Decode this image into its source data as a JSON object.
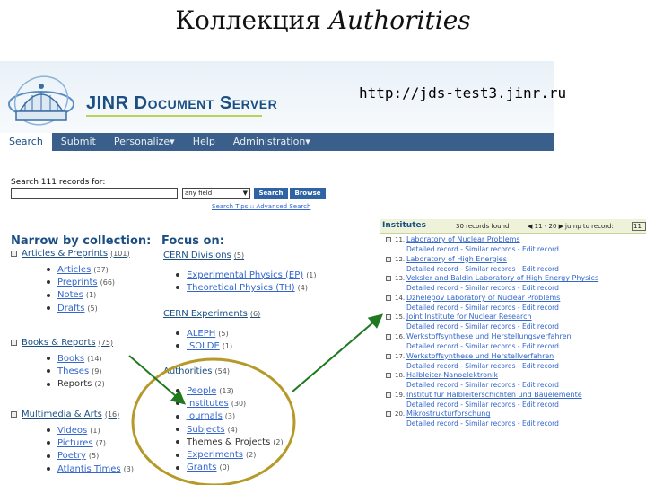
{
  "slide": {
    "title_plain": "Коллекция ",
    "title_italic": "Authorities"
  },
  "header": {
    "logo_text": "JINR Document Server",
    "url": "http://jds-test3.jinr.ru"
  },
  "nav": {
    "tabs": [
      "Search",
      "Submit",
      "Personalize▾",
      "Help",
      "Administration▾"
    ]
  },
  "search": {
    "label": "Search 111 records for:",
    "field_value": "any field",
    "search_button": "Search",
    "browse_button": "Browse",
    "links": "Search Tips :: Advanced Search"
  },
  "narrow": {
    "heading": "Narrow by collection:",
    "groups": [
      {
        "label": "Articles & Preprints",
        "count": "(101)",
        "items": [
          {
            "label": "Articles",
            "count": "(37)",
            "link": true
          },
          {
            "label": "Preprints",
            "count": "(66)",
            "link": true
          },
          {
            "label": "Notes",
            "count": "(1)",
            "link": true
          },
          {
            "label": "Drafts",
            "count": "(5)",
            "link": true
          }
        ]
      },
      {
        "label": "Books & Reports",
        "count": "(75)",
        "items": [
          {
            "label": "Books",
            "count": "(14)",
            "link": true
          },
          {
            "label": "Theses",
            "count": "(9)",
            "link": true
          },
          {
            "label": "Reports",
            "count": "(2)",
            "link": false
          }
        ]
      },
      {
        "label": "Multimedia & Arts",
        "count": "(16)",
        "items": [
          {
            "label": "Videos",
            "count": "(1)",
            "link": true
          },
          {
            "label": "Pictures",
            "count": "(7)",
            "link": true
          },
          {
            "label": "Poetry",
            "count": "(5)",
            "link": true
          },
          {
            "label": "Atlantis Times",
            "count": "(3)",
            "link": true
          }
        ]
      }
    ]
  },
  "focus": {
    "heading": "Focus on:",
    "groups": [
      {
        "label": "CERN Divisions",
        "count": "(5)",
        "items": [
          {
            "label": "Experimental Physics (EP)",
            "count": "(1)",
            "link": true
          },
          {
            "label": "Theoretical Physics (TH)",
            "count": "(4)",
            "link": true
          }
        ]
      },
      {
        "label": "CERN Experiments",
        "count": "(6)",
        "items": [
          {
            "label": "ALEPH",
            "count": "(5)",
            "link": true
          },
          {
            "label": "ISOLDE",
            "count": "(1)",
            "link": true
          }
        ]
      },
      {
        "label": "Authorities",
        "count": "(54)",
        "items": [
          {
            "label": "People",
            "count": "(13)",
            "link": true
          },
          {
            "label": "Institutes",
            "count": "(30)",
            "link": true
          },
          {
            "label": "Journals",
            "count": "(3)",
            "link": true
          },
          {
            "label": "Subjects",
            "count": "(4)",
            "link": true
          },
          {
            "label": "Themes & Projects",
            "count": "(2)",
            "link": false
          },
          {
            "label": "Experiments",
            "count": "(2)",
            "link": true
          },
          {
            "label": "Grants",
            "count": "(0)",
            "link": true
          }
        ]
      }
    ]
  },
  "results": {
    "title": "Institutes",
    "found": "30 records found",
    "range": "◀ 11 - 20 ▶",
    "jump": "jump to record:",
    "jump_value": "11",
    "links": "Detailed record - Similar records - Edit record",
    "records": [
      {
        "num": "11.",
        "name": "Laboratory of Nuclear Problems"
      },
      {
        "num": "12.",
        "name": "Laboratory of High Energies"
      },
      {
        "num": "13.",
        "name": "Veksler and Baldin Laboratory of High Energy Physics"
      },
      {
        "num": "14.",
        "name": "Dzhelepov Laboratory of Nuclear Problems"
      },
      {
        "num": "15.",
        "name": "Joint Institute for Nuclear Research"
      },
      {
        "num": "16.",
        "name": "Werkstoffsynthese und Herstellungsverfahren"
      },
      {
        "num": "17.",
        "name": "Werkstoffsynthese und Herstellverfahren"
      },
      {
        "num": "18.",
        "name": "Halbleiter-Nanoelektronik"
      },
      {
        "num": "19.",
        "name": "Institut fur Halbleiterschichten und Bauelemente"
      },
      {
        "num": "20.",
        "name": "Mikrostrukturforschung"
      }
    ]
  },
  "colors": {
    "brand": "#1b4f84",
    "nav": "#3a5f8a",
    "link": "#3366cc",
    "highlight_ring": "#b59a2a",
    "arrow": "#1f7a1f"
  }
}
